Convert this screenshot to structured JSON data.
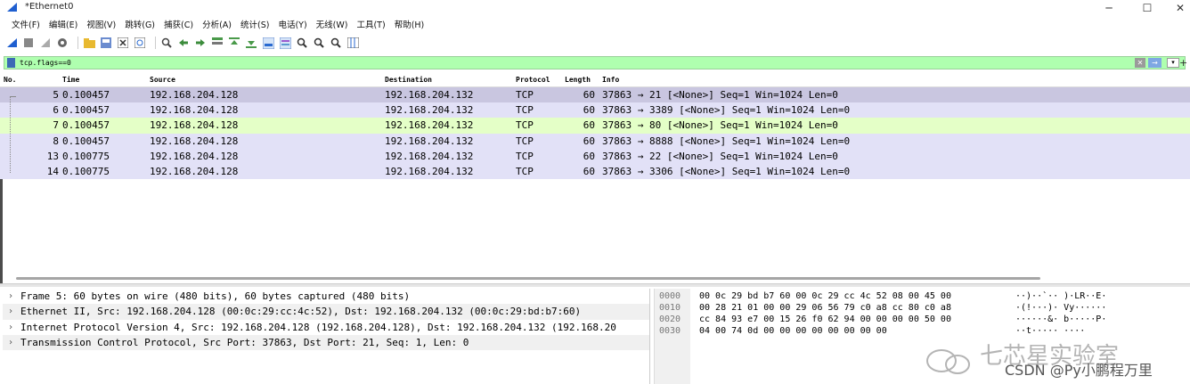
{
  "window": {
    "title": "*Ethernet0"
  },
  "menu": [
    "文件(F)",
    "编辑(E)",
    "视图(V)",
    "跳转(G)",
    "捕获(C)",
    "分析(A)",
    "统计(S)",
    "电话(Y)",
    "无线(W)",
    "工具(T)",
    "帮助(H)"
  ],
  "toolbar_icons": [
    "start-capture-icon",
    "stop-capture-icon",
    "restart-capture-icon",
    "capture-options-icon",
    "open-file-icon",
    "save-file-icon",
    "close-file-icon",
    "reload-file-icon",
    "find-packet-icon",
    "go-back-icon",
    "go-forward-icon",
    "go-to-packet-icon",
    "go-first-icon",
    "go-last-icon",
    "autoscroll-icon",
    "colorize-icon",
    "zoom-in-icon",
    "zoom-out-icon",
    "zoom-normal-icon",
    "resize-columns-icon"
  ],
  "filter": {
    "value": "tcp.flags==0"
  },
  "columns": {
    "no": "No.",
    "time": "Time",
    "source": "Source",
    "destination": "Destination",
    "protocol": "Protocol",
    "length": "Length",
    "info": "Info"
  },
  "packets": [
    {
      "no": "5",
      "time": "0.100457",
      "source": "192.168.204.128",
      "destination": "192.168.204.132",
      "protocol": "TCP",
      "length": "60",
      "info": "37863 → 21 [<None>] Seq=1 Win=1024 Len=0",
      "bg": "#c9c6e0"
    },
    {
      "no": "6",
      "time": "0.100457",
      "source": "192.168.204.128",
      "destination": "192.168.204.132",
      "protocol": "TCP",
      "length": "60",
      "info": "37863 → 3389 [<None>] Seq=1 Win=1024 Len=0",
      "bg": "#e2e1f7"
    },
    {
      "no": "7",
      "time": "0.100457",
      "source": "192.168.204.128",
      "destination": "192.168.204.132",
      "protocol": "TCP",
      "length": "60",
      "info": "37863 → 80 [<None>] Seq=1 Win=1024 Len=0",
      "bg": "#e4ffc7"
    },
    {
      "no": "8",
      "time": "0.100457",
      "source": "192.168.204.128",
      "destination": "192.168.204.132",
      "protocol": "TCP",
      "length": "60",
      "info": "37863 → 8888 [<None>] Seq=1 Win=1024 Len=0",
      "bg": "#e2e1f7"
    },
    {
      "no": "13",
      "time": "0.100775",
      "source": "192.168.204.128",
      "destination": "192.168.204.132",
      "protocol": "TCP",
      "length": "60",
      "info": "37863 → 22 [<None>] Seq=1 Win=1024 Len=0",
      "bg": "#e2e1f7"
    },
    {
      "no": "14",
      "time": "0.100775",
      "source": "192.168.204.128",
      "destination": "192.168.204.132",
      "protocol": "TCP",
      "length": "60",
      "info": "37863 → 3306 [<None>] Seq=1 Win=1024 Len=0",
      "bg": "#e2e1f7"
    }
  ],
  "details": [
    {
      "text": "Frame 5: 60 bytes on wire (480 bits), 60 bytes captured (480 bits)",
      "bg": "#ffffff"
    },
    {
      "text": "Ethernet II, Src: 192.168.204.128 (00:0c:29:cc:4c:52), Dst: 192.168.204.132 (00:0c:29:bd:b7:60)",
      "bg": "#f0f0f0"
    },
    {
      "text": "Internet Protocol Version 4, Src: 192.168.204.128 (192.168.204.128), Dst: 192.168.204.132 (192.168.20",
      "bg": "#ffffff"
    },
    {
      "text": "Transmission Control Protocol, Src Port: 37863, Dst Port: 21, Seq: 1, Len: 0",
      "bg": "#f0f0f0"
    }
  ],
  "bytes": [
    {
      "offset": "0000",
      "hex": "00 0c 29 bd b7 60 00 0c  29 cc 4c 52 08 00 45 00",
      "ascii": "··)··`·· )·LR··E·"
    },
    {
      "offset": "0010",
      "hex": "00 28 21 01 00 00 29 06  56 79 c0 a8 cc 80 c0 a8",
      "ascii": "·(!···)· Vy······"
    },
    {
      "offset": "0020",
      "hex": "cc 84 93 e7 00 15 26 f0  62 94 00 00 00 00 50 00",
      "ascii": "······&· b·····P·"
    },
    {
      "offset": "0030",
      "hex": "04 00 74 0d 00 00 00 00  00 00 00 00",
      "ascii": "··t····· ····"
    }
  ],
  "watermark": {
    "text": "七芯星实验室",
    "csdn": "CSDN @Py小鹏程万里"
  }
}
